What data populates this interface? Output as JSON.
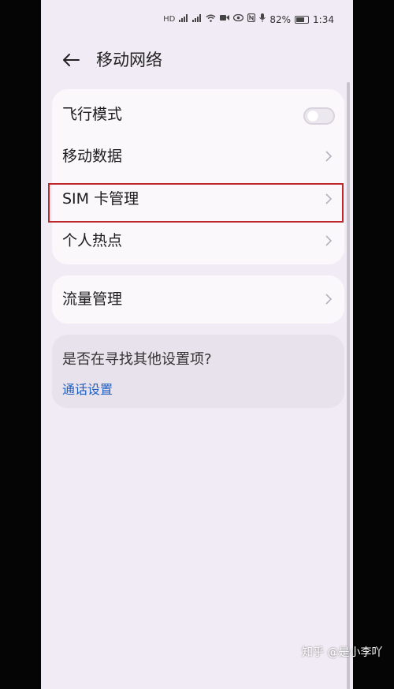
{
  "status_bar": {
    "battery": "82%",
    "time": "1:34",
    "icons": [
      "hd-icon",
      "signal-icon",
      "signal-icon",
      "wifi-icon",
      "camera-icon",
      "eye-icon",
      "nfc-icon",
      "microphone-icon",
      "battery-icon"
    ]
  },
  "header": {
    "back_icon": "arrow-left-icon",
    "title": "移动网络"
  },
  "group1": {
    "items": [
      {
        "label": "飞行模式",
        "control": "toggle",
        "state": "off"
      },
      {
        "label": "移动数据",
        "control": "chevron"
      },
      {
        "label": "SIM 卡管理",
        "control": "chevron"
      },
      {
        "label": "个人热点",
        "control": "chevron"
      }
    ]
  },
  "group2": {
    "items": [
      {
        "label": "流量管理",
        "control": "chevron"
      }
    ]
  },
  "suggestion": {
    "question": "是否在寻找其他设置项?",
    "link": "通话设置"
  },
  "watermark": "知乎 @是小李吖",
  "colors": {
    "background": "#f1ebf5",
    "card": "#fbf8fc",
    "link": "#1f5fbf",
    "highlight": "#c0272d"
  }
}
